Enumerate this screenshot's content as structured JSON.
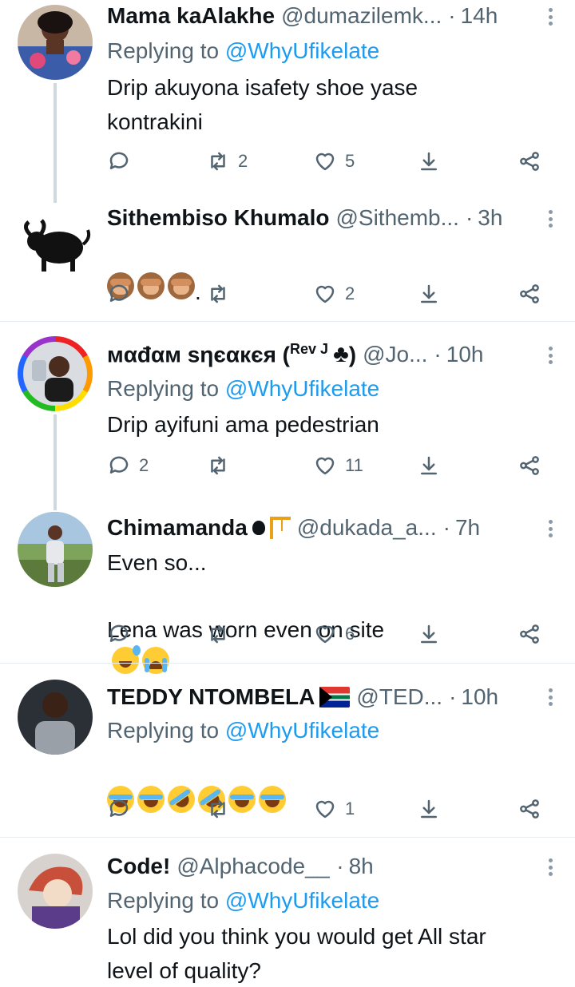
{
  "tweets": [
    {
      "name": "Mama kaAlakhe",
      "handle": "@dumazilemk...",
      "time": "14h",
      "replying_label": "Replying to",
      "replying_to": "@WhyUfikelate",
      "text": "Drip akuyona isafety shoe yase\nkontrakini",
      "replies": "",
      "retweets": "2",
      "likes": "5"
    },
    {
      "name": "Sithembiso Khumalo",
      "handle": "@Sithemb...",
      "time": "3h",
      "text": ".",
      "emojis": [
        "see-no-evil-monkey",
        "see-no-evil-monkey",
        "see-no-evil-monkey"
      ],
      "replies": "",
      "retweets": "",
      "likes": "2"
    },
    {
      "name": "мαđαм sηєαкєя (",
      "name_sup": "Rev J",
      "name_tail": ")",
      "handle": "@Jo...",
      "time": "10h",
      "replying_label": "Replying to",
      "replying_to": "@WhyUfikelate",
      "text": "Drip ayifuni ama pedestrian",
      "replies": "2",
      "retweets": "",
      "likes": "11"
    },
    {
      "name": "Chimamanda",
      "handle": "@dukada_a...",
      "time": "7h",
      "text": "Even so...",
      "text2": "Lena was worn even on site",
      "emojis": [
        "sweat-smile",
        "loudly-crying"
      ],
      "replies": "",
      "retweets": "",
      "likes": "6"
    },
    {
      "name": "TEDDY NTOMBELA",
      "handle": "@TED...",
      "time": "10h",
      "replying_label": "Replying to",
      "replying_to": "@WhyUfikelate",
      "emojis": [
        "joy",
        "joy",
        "rofl",
        "rofl",
        "joy",
        "joy"
      ],
      "replies": "",
      "retweets": "",
      "likes": "1"
    },
    {
      "name": "Code!",
      "handle": "@Alphacode__",
      "time": "8h",
      "replying_label": "Replying to",
      "replying_to": "@WhyUfikelate",
      "text": "Lol did you think you would get All star\nlevel of quality?"
    }
  ],
  "separator": "·",
  "colors": {
    "accent": "#1d9bf0",
    "muted": "#536471",
    "text": "#0f1419"
  }
}
